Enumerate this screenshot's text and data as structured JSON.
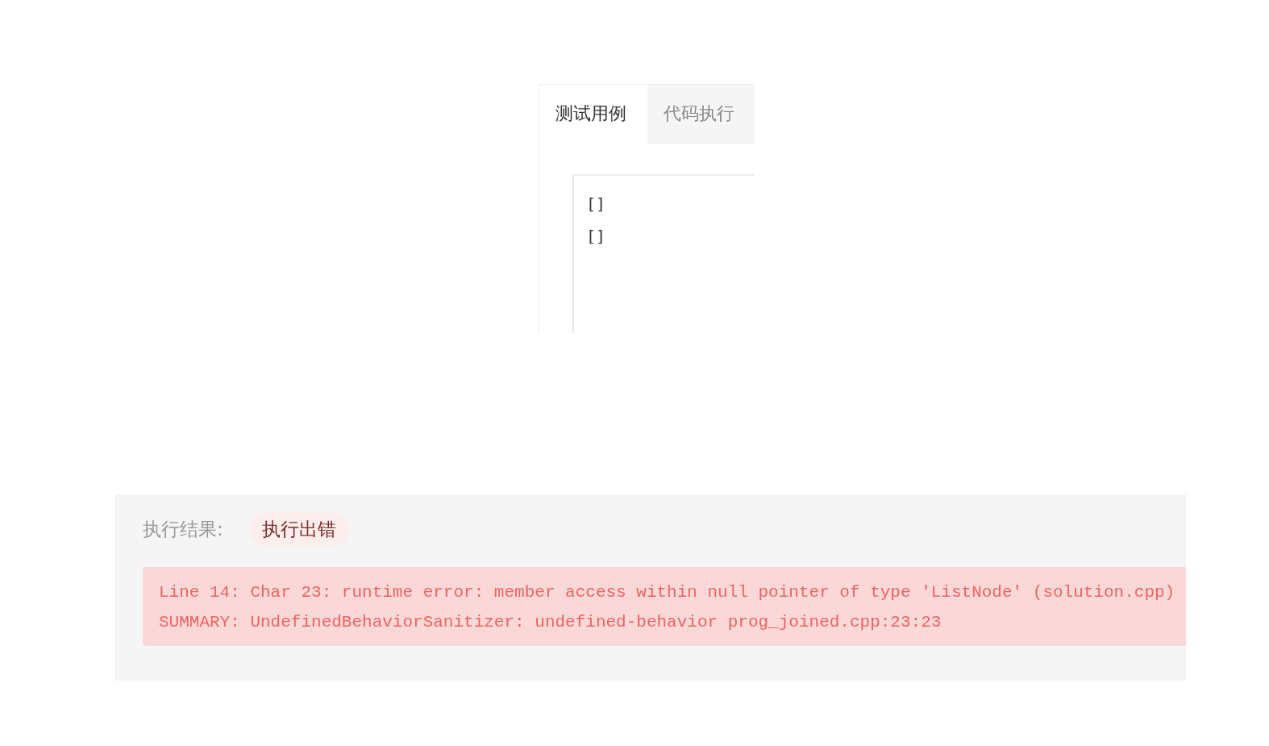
{
  "tabs": [
    {
      "label": "测试用例",
      "selected": true
    },
    {
      "label": "代码执行",
      "selected": false
    }
  ],
  "testcase": {
    "lines": [
      "[]",
      "[]"
    ]
  },
  "result": {
    "label": "执行结果:",
    "status": "执行出错",
    "error_lines": [
      "Line 14: Char 23: runtime error: member access within null pointer of type 'ListNode' (solution.cpp)",
      "SUMMARY: UndefinedBehaviorSanitizer: undefined-behavior prog_joined.cpp:23:23"
    ]
  }
}
